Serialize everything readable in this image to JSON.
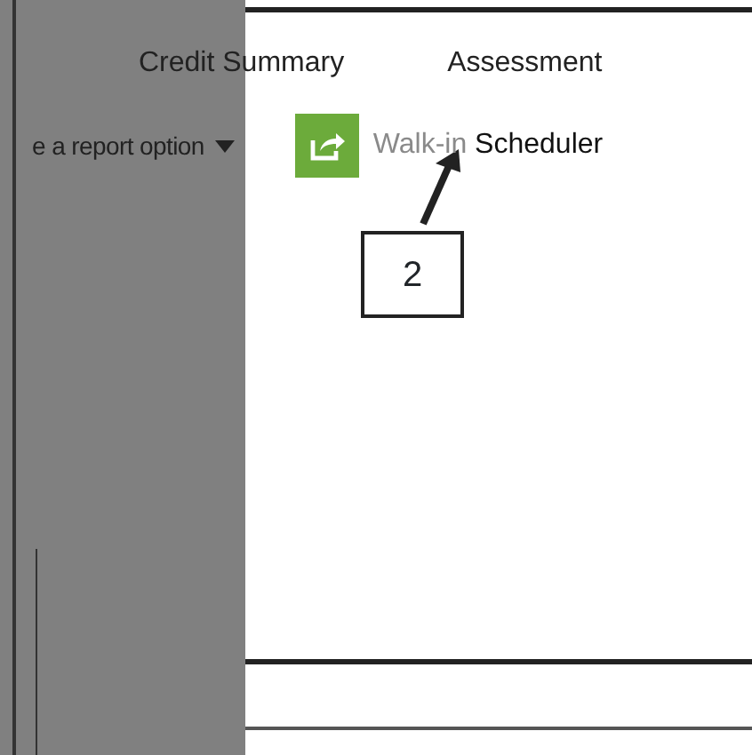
{
  "tabs": [
    {
      "label": "Credit Summary"
    },
    {
      "label": "Assessment"
    }
  ],
  "report_select": {
    "value": "e a report option"
  },
  "walkin_link": {
    "highlight": "Walk-in",
    "rest": "Scheduler"
  },
  "callout": {
    "label": "2"
  }
}
